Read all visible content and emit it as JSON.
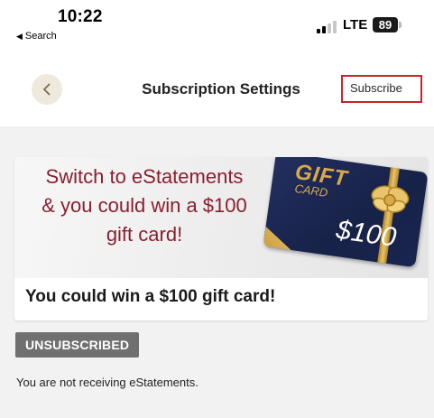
{
  "status_bar": {
    "time": "10:22",
    "back_app": "Search",
    "network": "LTE",
    "battery": "89"
  },
  "nav": {
    "title": "Subscription Settings",
    "subscribe_label": "Subscribe"
  },
  "promo": {
    "lines": [
      "Switch to eStatements",
      "& you could win a $100",
      "gift card!"
    ],
    "gift_word": "GIFT",
    "card_word": "CARD",
    "amount": "$100",
    "caption": "You could win a $100 gift card!"
  },
  "subscription": {
    "status": "UNSUBSCRIBED",
    "note": "You are not receiving eStatements."
  },
  "colors": {
    "accent": "#c8222a",
    "promo_text": "#8b1e2e",
    "badge_bg": "#707070",
    "card_navy": "#172248",
    "gold": "#d9a84a"
  }
}
